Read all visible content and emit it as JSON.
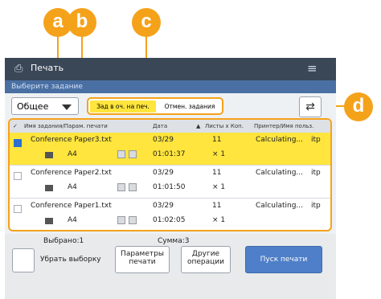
{
  "callouts": {
    "a": "a",
    "b": "b",
    "c": "c",
    "d": "d"
  },
  "window": {
    "title": "Печать",
    "subtitle": "Выберите задание"
  },
  "filter": {
    "selected": "Общее"
  },
  "tabs": [
    {
      "label": "Зад в оч. на печ."
    },
    {
      "label": "Отмен. задания"
    }
  ],
  "icons": {
    "refresh": "refresh-icon",
    "menu": "menu-icon",
    "printer": "printer-icon"
  },
  "table": {
    "headers": [
      "Имя задания/Парам. печати",
      "Дата",
      "Листы x Коп.",
      "Принтер/Имя польз."
    ],
    "rows": [
      {
        "name": "Conference Paper3.txt",
        "size": "A4",
        "date": "03/29",
        "time": "01:01:37",
        "sheets": "11",
        "copies": "× 1",
        "owner": "Calculating...",
        "user": "itp",
        "selected": true
      },
      {
        "name": "Conference Paper2.txt",
        "size": "A4",
        "date": "03/29",
        "time": "01:01:50",
        "sheets": "11",
        "copies": "× 1",
        "owner": "Calculating...",
        "user": "itp",
        "selected": false
      },
      {
        "name": "Conference Paper1.txt",
        "size": "A4",
        "date": "03/29",
        "time": "01:02:05",
        "sheets": "11",
        "copies": "× 1",
        "owner": "Calculating...",
        "user": "itp",
        "selected": false
      }
    ]
  },
  "footer": {
    "selected_label": "Выбрано:1",
    "total_label": "Сумма:3",
    "clear_button": "Убрать выборку",
    "settings_button_line1": "Параметры",
    "settings_button_line2": "печати",
    "other_button_line1": "Другие",
    "other_button_line2": "операции",
    "start_button": "Пуск печати"
  },
  "colors": {
    "accent": "#f5a21b",
    "selected_row": "#ffe53d",
    "primary": "#4f7fc8"
  }
}
